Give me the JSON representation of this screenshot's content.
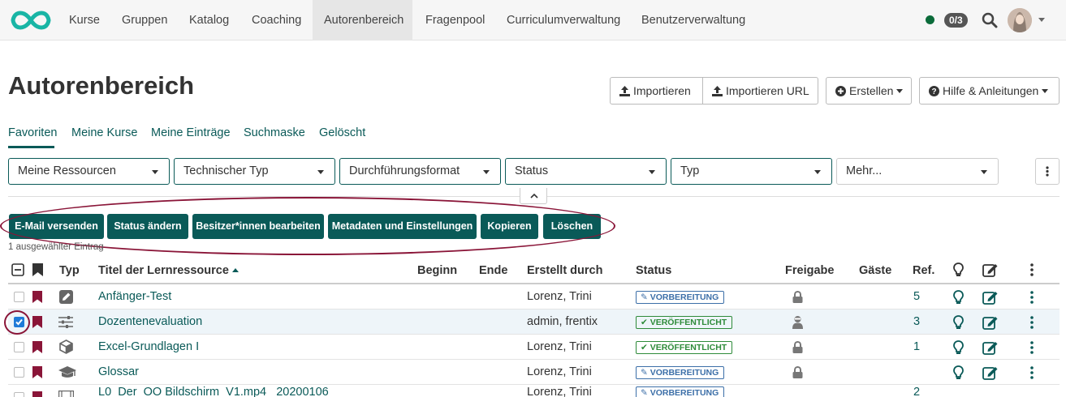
{
  "nav": {
    "items": [
      "Kurse",
      "Gruppen",
      "Katalog",
      "Coaching",
      "Autorenbereich",
      "Fragenpool",
      "Curriculumverwaltung",
      "Benutzerverwaltung"
    ],
    "counter": "0/3"
  },
  "page": {
    "title": "Autorenbereich"
  },
  "header_buttons": {
    "import": "Importieren",
    "import_url": "Importieren URL",
    "create": "Erstellen",
    "help": "Hilfe & Anleitungen"
  },
  "tabs": [
    "Favoriten",
    "Meine Kurse",
    "Meine Einträge",
    "Suchmaske",
    "Gelöscht"
  ],
  "filters": [
    "Meine Ressourcen",
    "Technischer Typ",
    "Durchführungsformat",
    "Status",
    "Typ",
    "Mehr..."
  ],
  "actions": [
    "E-Mail versenden",
    "Status ändern",
    "Besitzer*innen bearbeiten",
    "Metadaten und Einstellungen",
    "Kopieren",
    "Löschen"
  ],
  "selection_note": "1 ausgewählter Eintrag",
  "table": {
    "headers": {
      "type": "Typ",
      "title": "Titel der Lernressource",
      "begin": "Beginn",
      "end": "Ende",
      "created_by": "Erstellt durch",
      "status": "Status",
      "release": "Freigabe",
      "guests": "Gäste",
      "refs": "Ref."
    },
    "rows": [
      {
        "title": "Anfänger-Test",
        "created_by": "Lorenz, Trini",
        "status": "VORBEREITUNG",
        "refs": "5"
      },
      {
        "title": "Dozentenevaluation",
        "created_by": "admin, frentix",
        "status": "VERÖFFENTLICHT",
        "refs": "3"
      },
      {
        "title": "Excel-Grundlagen I",
        "created_by": "Lorenz, Trini",
        "status": "VERÖFFENTLICHT",
        "refs": "1"
      },
      {
        "title": "Glossar",
        "created_by": "Lorenz, Trini",
        "status": "VORBEREITUNG",
        "refs": ""
      },
      {
        "title": "L0_Der_OO Bildschirm_V1.mp4 _20200106",
        "created_by": "Lorenz, Trini",
        "status": "VORBEREITUNG",
        "refs": "2"
      }
    ]
  },
  "colors": {
    "brand": "#0a5a58",
    "highlight": "#8a1538",
    "bookmark": "#8a1538",
    "published": "#2e8b3a",
    "preparation": "#3c6fa8"
  }
}
